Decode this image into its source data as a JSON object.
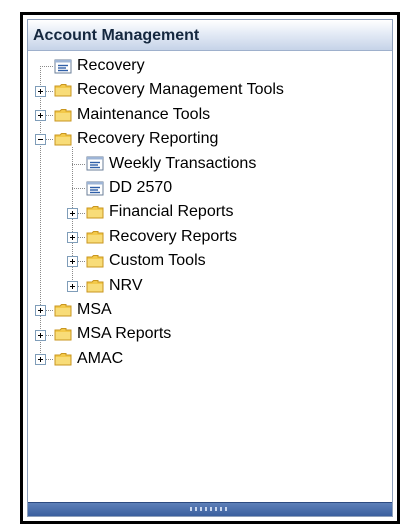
{
  "panel": {
    "title": "Account Management"
  },
  "tree": [
    {
      "id": "recovery",
      "label": "Recovery",
      "level": 0,
      "kind": "document",
      "expander": "none"
    },
    {
      "id": "recovery-management-tools",
      "label": "Recovery Management Tools",
      "level": 0,
      "kind": "folder",
      "expander": "plus"
    },
    {
      "id": "maintenance-tools",
      "label": "Maintenance Tools",
      "level": 0,
      "kind": "folder",
      "expander": "plus"
    },
    {
      "id": "recovery-reporting",
      "label": "Recovery Reporting",
      "level": 0,
      "kind": "folder",
      "expander": "minus"
    },
    {
      "id": "weekly-transactions",
      "label": "Weekly Transactions",
      "level": 1,
      "kind": "document",
      "expander": "none"
    },
    {
      "id": "dd-2570",
      "label": "DD 2570",
      "level": 1,
      "kind": "document",
      "expander": "none"
    },
    {
      "id": "financial-reports",
      "label": "Financial Reports",
      "level": 1,
      "kind": "folder",
      "expander": "plus"
    },
    {
      "id": "recovery-reports",
      "label": "Recovery Reports",
      "level": 1,
      "kind": "folder",
      "expander": "plus"
    },
    {
      "id": "custom-tools",
      "label": "Custom Tools",
      "level": 1,
      "kind": "folder",
      "expander": "plus"
    },
    {
      "id": "nrv",
      "label": "NRV",
      "level": 1,
      "kind": "folder",
      "expander": "plus"
    },
    {
      "id": "msa",
      "label": "MSA",
      "level": 0,
      "kind": "folder",
      "expander": "plus"
    },
    {
      "id": "msa-reports",
      "label": "MSA Reports",
      "level": 0,
      "kind": "folder",
      "expander": "plus"
    },
    {
      "id": "amac",
      "label": "AMAC",
      "level": 0,
      "kind": "folder",
      "expander": "plus"
    }
  ],
  "colors": {
    "folder": "#f3c94a",
    "folder_edge": "#c9961f",
    "doc_lines": "#2f5fa8",
    "title_text": "#15283f"
  }
}
